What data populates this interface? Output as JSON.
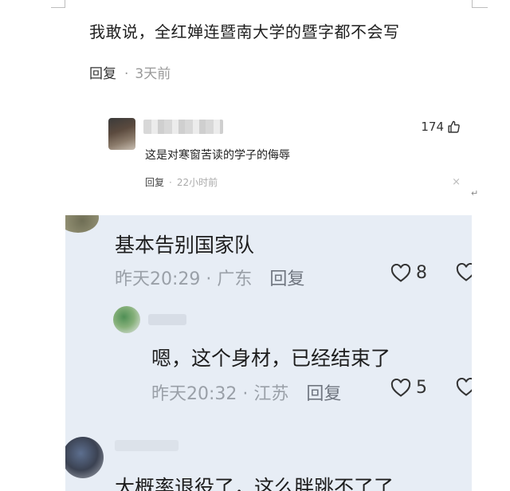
{
  "comment1": {
    "text": "我敢说，全红婵连暨南大学的暨字都不会写",
    "reply_label": "回复",
    "dot": "·",
    "time": "3天前",
    "reply": {
      "likes": "174",
      "text": "这是对寒窗苦读的学子的侮辱",
      "reply_label": "回复",
      "dot": "·",
      "time": "22小时前",
      "close": "×"
    }
  },
  "paragraph_mark": "↵",
  "comment2": {
    "text": "基本告别国家队",
    "meta": "昨天20:29 · 广东",
    "reply_label": "回复",
    "likes": "8",
    "reply": {
      "text": "嗯，这个身材，已经结束了",
      "meta": "昨天20:32 · 江苏",
      "reply_label": "回复",
      "likes": "5"
    }
  },
  "comment3": {
    "text": "大概率退役了，这么胖跳不了了"
  }
}
